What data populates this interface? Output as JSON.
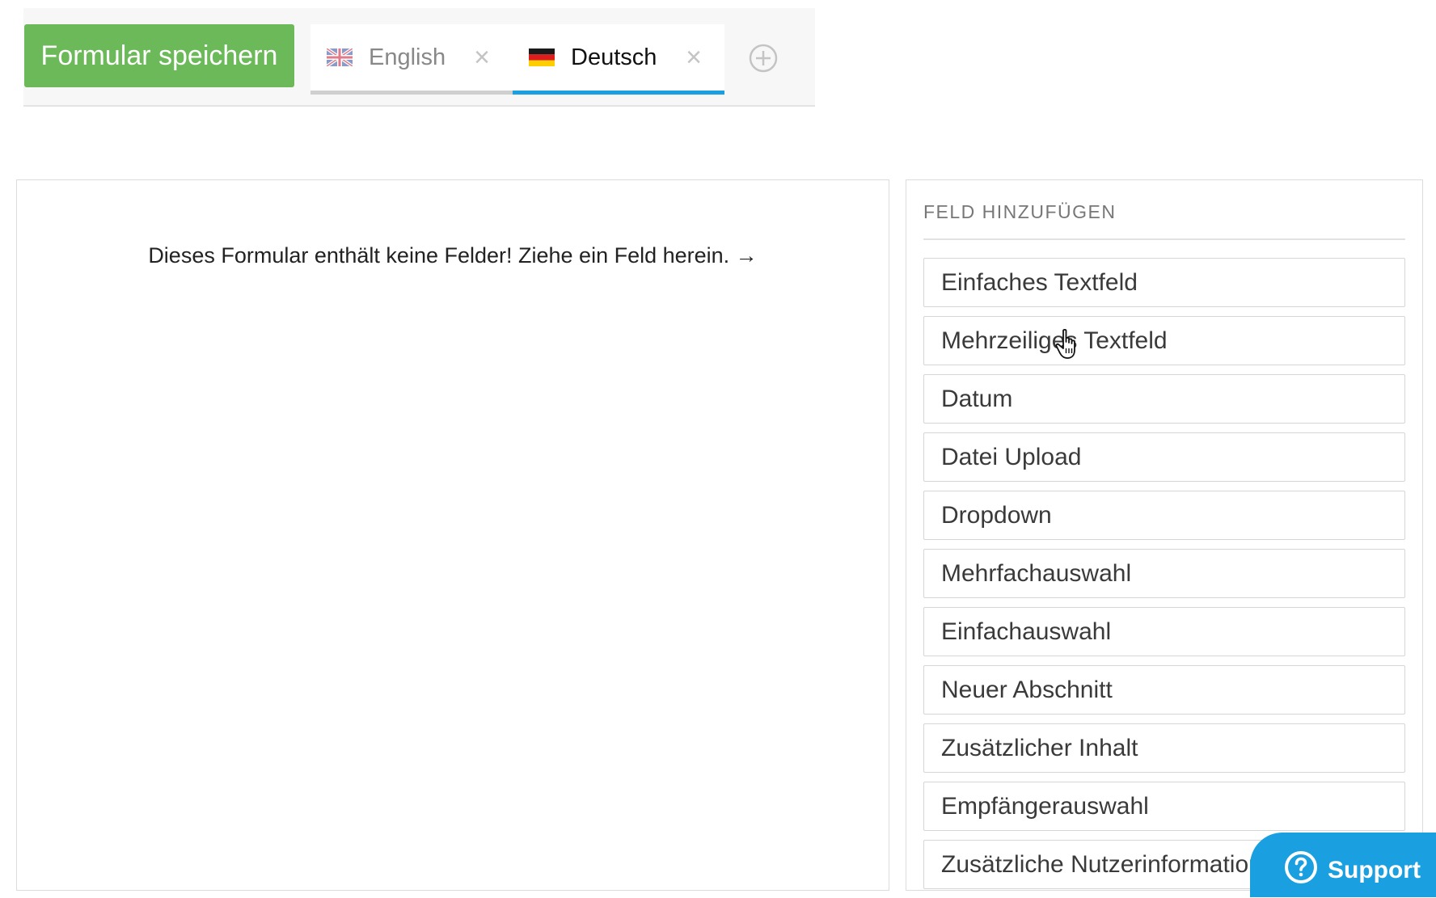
{
  "toolbar": {
    "save_label": "Formular speichern"
  },
  "tabs": [
    {
      "label": "English",
      "flag": "uk-flag-icon",
      "active": false,
      "close": "×"
    },
    {
      "label": "Deutsch",
      "flag": "de-flag-icon",
      "active": true,
      "close": "×"
    }
  ],
  "add_tab_icon": "plus-circle-icon",
  "form": {
    "empty_message": "Dieses Formular enthält keine Felder! Ziehe ein Feld herein. →"
  },
  "sidebar": {
    "title": "FELD HINZUFÜGEN",
    "items": [
      {
        "label": "Einfaches Textfeld"
      },
      {
        "label": "Mehrzeiliges Textfeld"
      },
      {
        "label": "Datum"
      },
      {
        "label": "Datei Upload"
      },
      {
        "label": "Dropdown"
      },
      {
        "label": "Mehrfachauswahl"
      },
      {
        "label": "Einfachauswahl"
      },
      {
        "label": "Neuer Abschnitt"
      },
      {
        "label": "Zusätzlicher Inhalt"
      },
      {
        "label": "Empfängerauswahl"
      },
      {
        "label": "Zusätzliche Nutzerinformation"
      }
    ]
  },
  "support": {
    "label": "Support",
    "icon": "question-circle-icon"
  },
  "colors": {
    "save_green": "#6cb95a",
    "active_tab_blue": "#1a9fe0",
    "support_blue": "#1a9fe0"
  }
}
